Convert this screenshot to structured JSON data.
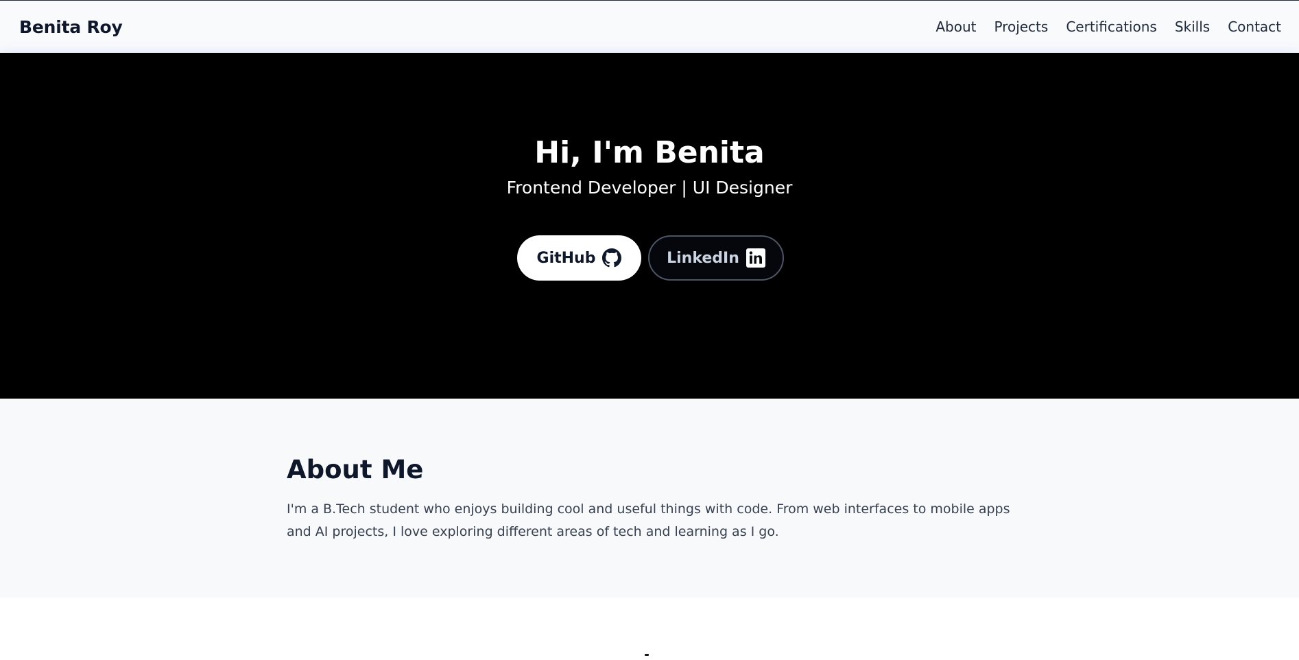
{
  "header": {
    "brand": "Benita Roy",
    "nav": [
      "About",
      "Projects",
      "Certifications",
      "Skills",
      "Contact"
    ]
  },
  "hero": {
    "title": "Hi, I'm Benita",
    "subtitle": "Frontend Developer | UI Designer",
    "buttons": [
      {
        "label": "GitHub",
        "icon": "github-icon"
      },
      {
        "label": "LinkedIn",
        "icon": "linkedin-icon"
      }
    ]
  },
  "about": {
    "title": "About Me",
    "text": "I'm a B.Tech student who enjoys building cool and useful things with code. From web interfaces to mobile apps and AI projects, I love exploring different areas of tech and learning as I go."
  },
  "colors": {
    "hero_background": "#000000",
    "hero_glow": "#6366f1",
    "page_background": "#f8f9fb"
  }
}
